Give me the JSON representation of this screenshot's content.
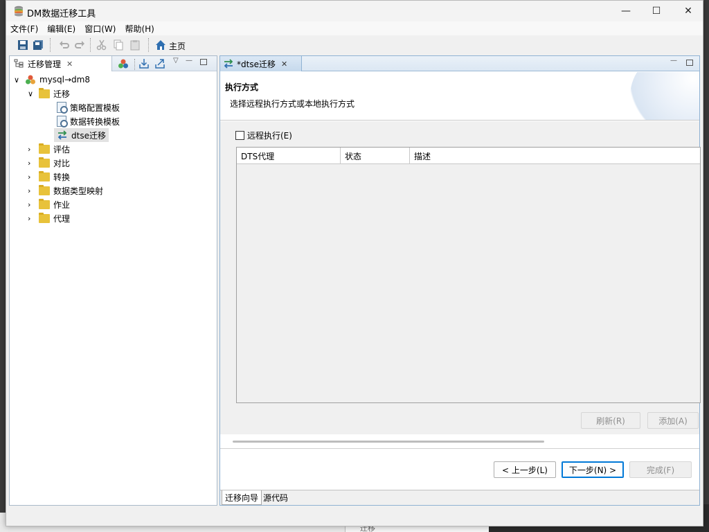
{
  "window": {
    "title": "DM数据迁移工具"
  },
  "window_controls": {
    "minimize": "—",
    "maximize": "☐",
    "close": "✕"
  },
  "menu": [
    "文件(F)",
    "编辑(E)",
    "窗口(W)",
    "帮助(H)"
  ],
  "toolbar": {
    "home_label": "主页"
  },
  "left_view": {
    "tab_label": "迁移管理",
    "tree": {
      "root": "mysql→dm8",
      "migration_folder": "迁移",
      "migration_children": [
        "策略配置模板",
        "数据转换模板",
        "dtse迁移"
      ],
      "folders": [
        "评估",
        "对比",
        "转换",
        "数据类型映射",
        "作业",
        "代理"
      ]
    }
  },
  "editor": {
    "tab_label": "*dtse迁移",
    "header_title": "执行方式",
    "header_desc": "选择远程执行方式或本地执行方式",
    "remote_checkbox_label": "远程执行(E)",
    "remote_checked": false,
    "table_columns": [
      "DTS代理",
      "状态",
      "描述"
    ],
    "refresh_button": "刷新(R)",
    "add_button": "添加(A)",
    "prev_button": "< 上一步(L)",
    "next_button": "下一步(N) >",
    "finish_button": "完成(F)",
    "bottom_tabs": [
      "迁移向导",
      "源代码"
    ]
  },
  "background": {
    "snippet": "迁移"
  }
}
